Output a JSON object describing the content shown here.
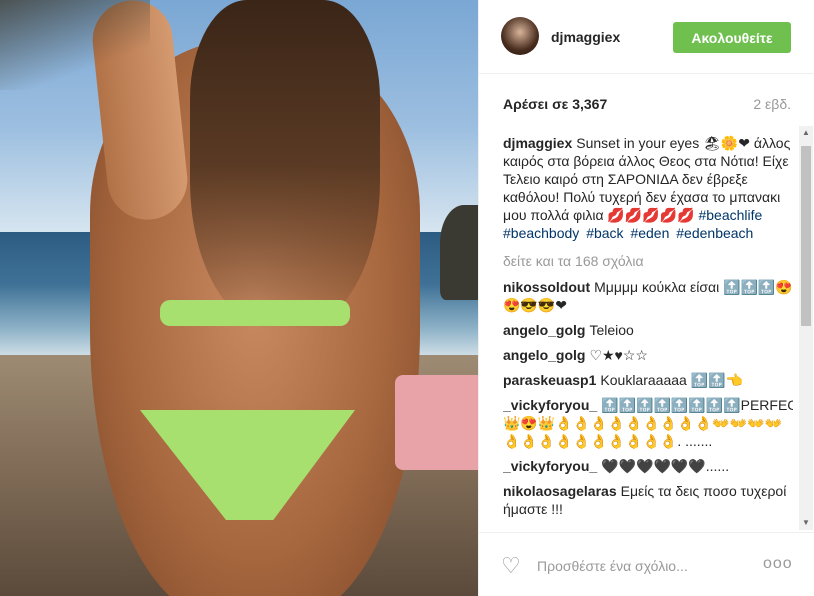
{
  "post": {
    "username": "djmaggiex",
    "follow_label": "Ακολουθείτε",
    "likes": "Αρέσει σε 3,367",
    "time_ago": "2 εβδ.",
    "caption_author": "djmaggiex",
    "caption_text": "Sunset in your eyes 🏖🌼❤ άλλος καιρός στα βόρεια άλλος Θεος στα Νότια! Είχε Τελειο καιρό στη ΣΑΡΟΝΙΔΑ δεν έβρεξε καθόλου! Πολύ τυχερή δεν έχασα το μπανακι μου πολλά φιλια 💋💋💋💋💋",
    "tags": [
      "#beachlife",
      "#beachbody",
      "#back",
      "#eden",
      "#edenbeach"
    ],
    "view_all": "δείτε και τα 168 σχόλια"
  },
  "comments": [
    {
      "author": "nikossoldout",
      "text": "Μμμμμ κούκλα είσαι 🔝🔝🔝😍😍😎😎❤"
    },
    {
      "author": "angelo_golg",
      "text": "Teleioo"
    },
    {
      "author": "angelo_golg",
      "text": "♡★♥☆☆"
    },
    {
      "author": "paraskeuasp1",
      "text": "Kouklaraaaaa 🔝🔝👈"
    },
    {
      "author": "_vickyforyou_",
      "text": "🔝🔝🔝🔝🔝🔝🔝🔝PERFECT 👑😍👑👌👌👌👌👌👌👌👌👌👐👐👐👐👌👌👌👌👌👌👌👌👌👌. ......."
    },
    {
      "author": "_vickyforyou_",
      "text": "🖤🖤🖤🖤🖤🖤......"
    },
    {
      "author": "nikolaosagelaras",
      "text": "Εμείς τα δεις ποσο τυχεροί ήμαστε !!!"
    }
  ],
  "footer": {
    "comment_placeholder": "Προσθέστε ένα σχόλιο...",
    "heart_icon": "heart-outline-icon",
    "more_icon": "more-options-icon",
    "more_glyph": "ooo",
    "heart_glyph": "♡"
  },
  "colors": {
    "follow_button": "#70c050",
    "hashtag": "#003569",
    "muted": "#999999"
  }
}
